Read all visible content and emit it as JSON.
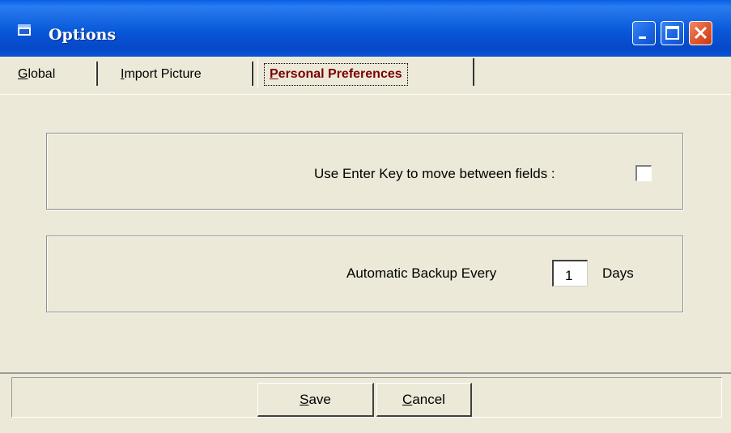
{
  "window": {
    "title": "Options"
  },
  "tabs": [
    {
      "label": "Global",
      "mnemonic": "G",
      "rest": "lobal",
      "active": false
    },
    {
      "label": "Import Picture",
      "mnemonic": "I",
      "rest": "mport Picture",
      "active": false
    },
    {
      "label": "Personal Preferences",
      "mnemonic": "P",
      "rest": "ersonal Preferences",
      "active": true
    }
  ],
  "preferences": {
    "enter_key_label": "Use Enter Key to move between fields :",
    "enter_key_checked": false,
    "backup_label": "Automatic Backup Every",
    "backup_value": "1",
    "backup_unit": "Days"
  },
  "buttons": {
    "save": {
      "mnemonic": "S",
      "rest": "ave",
      "label": "Save"
    },
    "cancel": {
      "mnemonic": "C",
      "rest": "ancel",
      "label": "Cancel"
    }
  },
  "colors": {
    "titlebar": "#0858d8",
    "active_tab_text": "#7a0000",
    "dialog_bg": "#ece9d8"
  },
  "icons": [
    "window-icon",
    "minimize-icon",
    "maximize-icon",
    "close-icon"
  ]
}
